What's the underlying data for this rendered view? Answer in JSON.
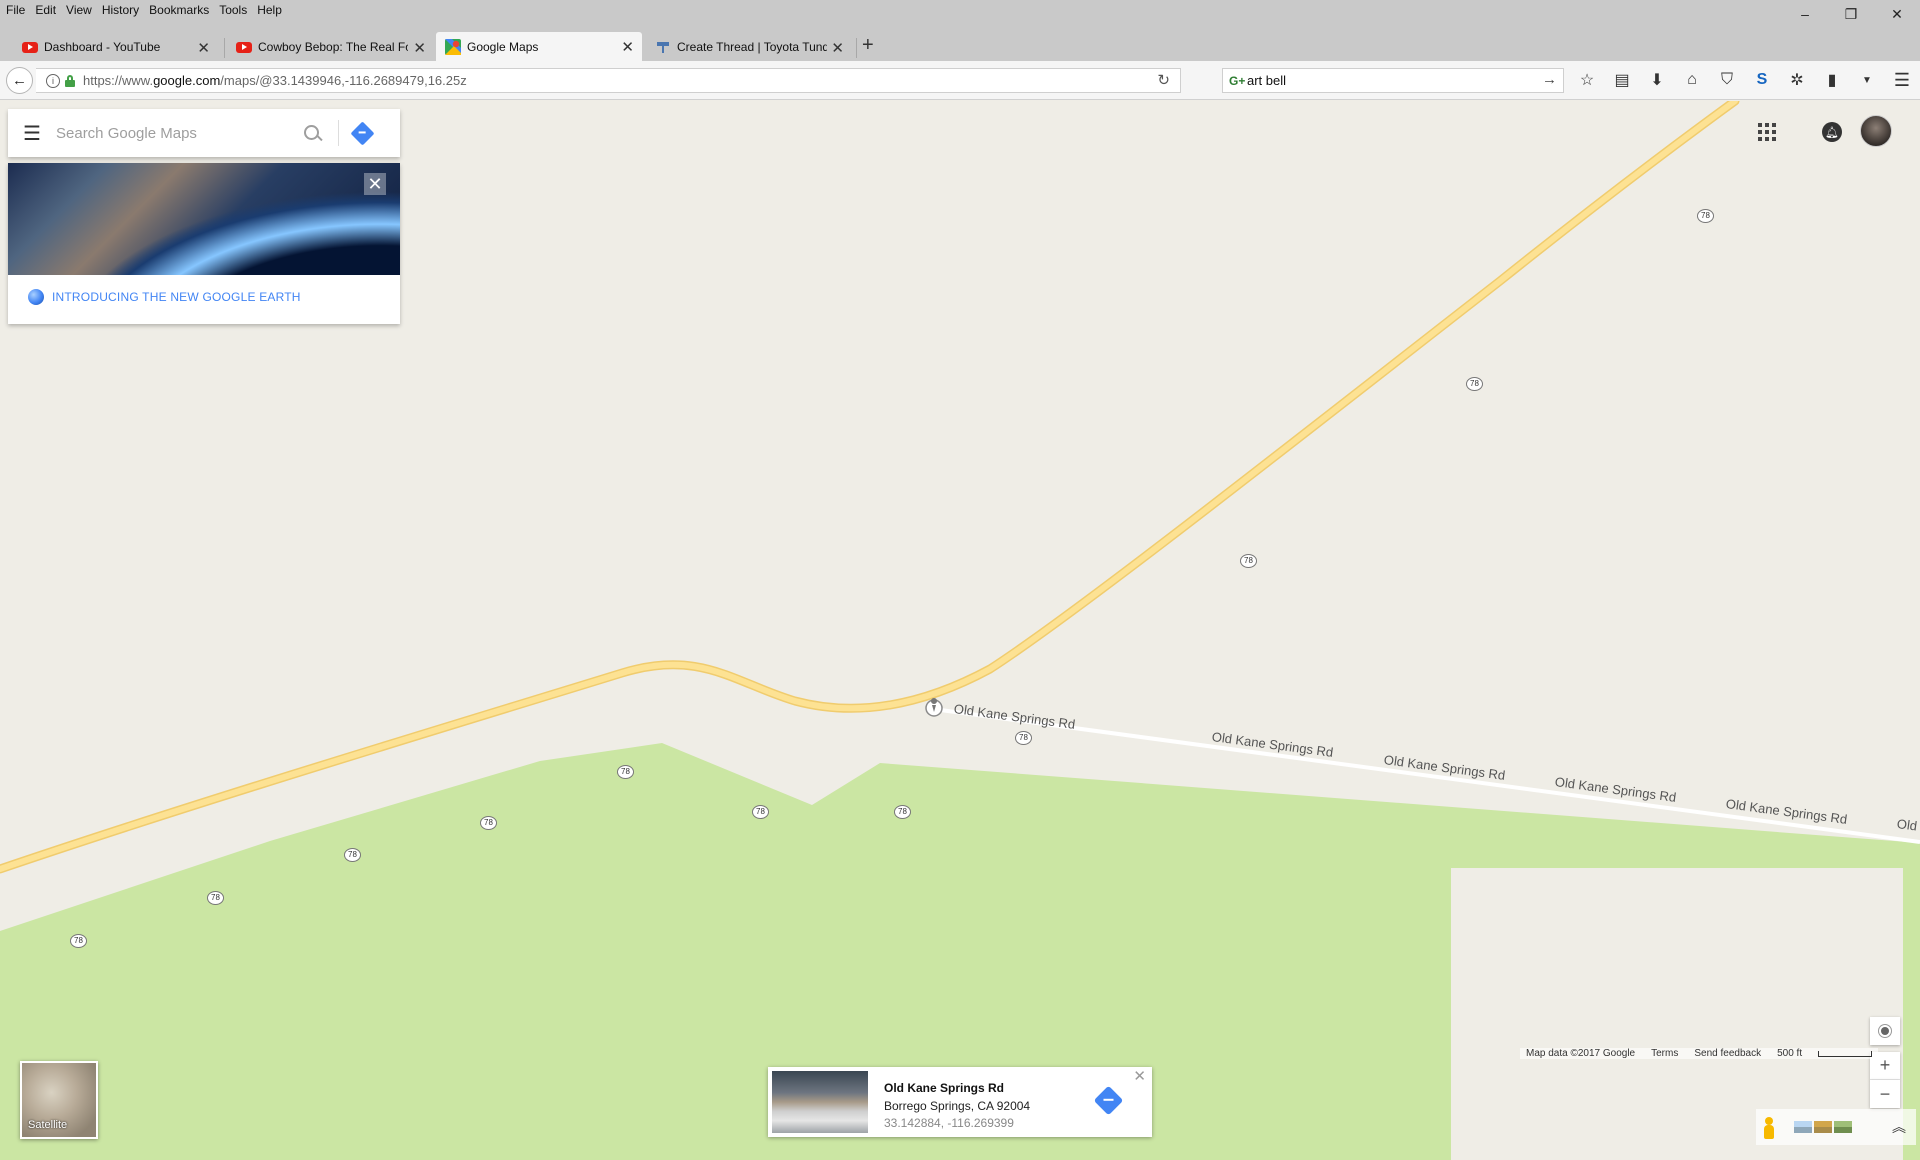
{
  "browser": {
    "menu": [
      "File",
      "Edit",
      "View",
      "History",
      "Bookmarks",
      "Tools",
      "Help"
    ],
    "tabs": [
      {
        "label": "Dashboard - YouTube",
        "favicon": "youtube-icon",
        "active": false
      },
      {
        "label": "Cowboy Bebop: The Real Fo",
        "favicon": "youtube-icon",
        "active": false
      },
      {
        "label": "Google Maps",
        "favicon": "google-maps-icon",
        "active": true
      },
      {
        "label": "Create Thread | Toyota Tund",
        "favicon": "forum-icon",
        "active": false
      }
    ],
    "url": {
      "prefix": "https://www.",
      "domain": "google.com",
      "path": "/maps/@33.1439946,-116.2689479,16.25z"
    },
    "search_value": "art bell"
  },
  "maps": {
    "search_placeholder": "Search Google Maps",
    "promo_text": "INTRODUCING THE NEW GOOGLE EARTH",
    "route_shield": "78",
    "road_name": "Old Kane Springs Rd",
    "road_name_cut": "Old",
    "satellite_label": "Satellite",
    "place": {
      "name": "Old Kane Springs Rd",
      "address": "Borrego Springs, CA 92004",
      "coords": "33.142884, -116.269399"
    },
    "attribution": {
      "map_data": "Map data ©2017 Google",
      "terms": "Terms",
      "feedback": "Send feedback",
      "scale": "500 ft"
    }
  },
  "colors": {
    "map_base": "#efede6",
    "park_green": "#cbe6a3",
    "highway_fill": "#fde293",
    "highway_stroke": "#f0cc6e",
    "accent_blue": "#4285f4"
  }
}
